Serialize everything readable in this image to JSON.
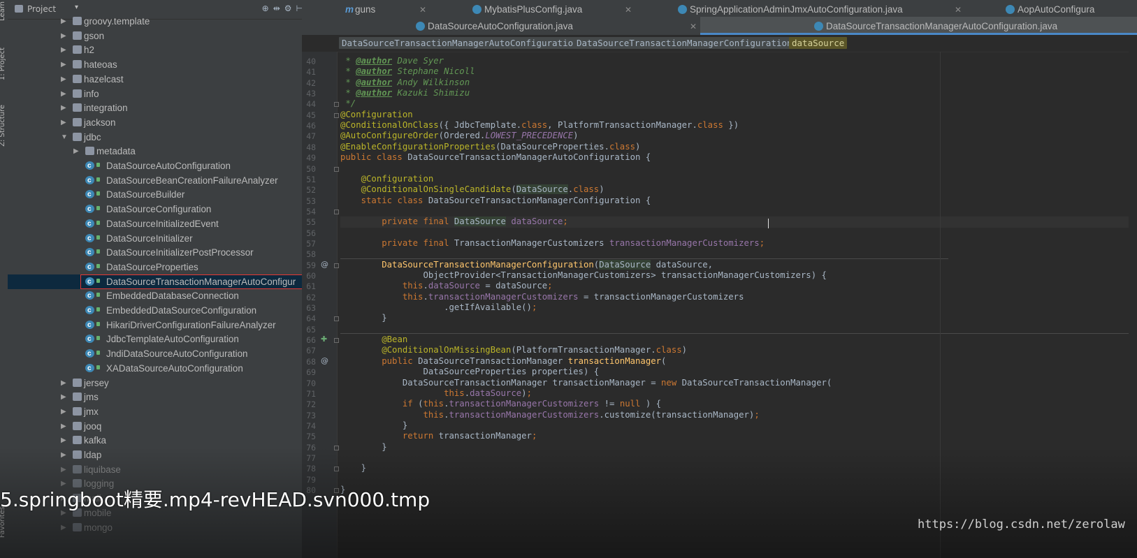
{
  "window": {
    "sidebar_tabs": [
      "Learn",
      "1: Project",
      "Z: Structure",
      "Favorites"
    ]
  },
  "project_panel": {
    "title": "Project",
    "header_icons": [
      "target-icon",
      "split-icon",
      "gear-icon",
      "collapse-icon"
    ],
    "tree": [
      {
        "label": "groovy.template",
        "type": "package",
        "depth": 1,
        "expanded": false
      },
      {
        "label": "gson",
        "type": "package",
        "depth": 1,
        "expanded": false
      },
      {
        "label": "h2",
        "type": "package",
        "depth": 1,
        "expanded": false
      },
      {
        "label": "hateoas",
        "type": "package",
        "depth": 1,
        "expanded": false
      },
      {
        "label": "hazelcast",
        "type": "package",
        "depth": 1,
        "expanded": false
      },
      {
        "label": "info",
        "type": "package",
        "depth": 1,
        "expanded": false
      },
      {
        "label": "integration",
        "type": "package",
        "depth": 1,
        "expanded": false
      },
      {
        "label": "jackson",
        "type": "package",
        "depth": 1,
        "expanded": false
      },
      {
        "label": "jdbc",
        "type": "package",
        "depth": 1,
        "expanded": true
      },
      {
        "label": "metadata",
        "type": "package",
        "depth": 2,
        "expanded": false
      },
      {
        "label": "DataSourceAutoConfiguration",
        "type": "class",
        "depth": 2
      },
      {
        "label": "DataSourceBeanCreationFailureAnalyzer",
        "type": "class",
        "depth": 2
      },
      {
        "label": "DataSourceBuilder",
        "type": "class",
        "depth": 2
      },
      {
        "label": "DataSourceConfiguration",
        "type": "class",
        "depth": 2
      },
      {
        "label": "DataSourceInitializedEvent",
        "type": "class",
        "depth": 2
      },
      {
        "label": "DataSourceInitializer",
        "type": "class",
        "depth": 2
      },
      {
        "label": "DataSourceInitializerPostProcessor",
        "type": "class",
        "depth": 2
      },
      {
        "label": "DataSourceProperties",
        "type": "class",
        "depth": 2
      },
      {
        "label": "DataSourceTransactionManagerAutoConfigur",
        "type": "class",
        "depth": 2,
        "selected": true
      },
      {
        "label": "EmbeddedDatabaseConnection",
        "type": "class",
        "depth": 2
      },
      {
        "label": "EmbeddedDataSourceConfiguration",
        "type": "class",
        "depth": 2
      },
      {
        "label": "HikariDriverConfigurationFailureAnalyzer",
        "type": "class",
        "depth": 2
      },
      {
        "label": "JdbcTemplateAutoConfiguration",
        "type": "class",
        "depth": 2
      },
      {
        "label": "JndiDataSourceAutoConfiguration",
        "type": "class",
        "depth": 2
      },
      {
        "label": "XADataSourceAutoConfiguration",
        "type": "class",
        "depth": 2
      },
      {
        "label": "jersey",
        "type": "package",
        "depth": 1,
        "expanded": false
      },
      {
        "label": "jms",
        "type": "package",
        "depth": 1,
        "expanded": false
      },
      {
        "label": "jmx",
        "type": "package",
        "depth": 1,
        "expanded": false
      },
      {
        "label": "jooq",
        "type": "package",
        "depth": 1,
        "expanded": false
      },
      {
        "label": "kafka",
        "type": "package",
        "depth": 1,
        "expanded": false
      },
      {
        "label": "ldap",
        "type": "package",
        "depth": 1,
        "expanded": false
      },
      {
        "label": "liquibase",
        "type": "package",
        "depth": 1,
        "expanded": false
      },
      {
        "label": "logging",
        "type": "package",
        "depth": 1,
        "expanded": false
      },
      {
        "label": "mail",
        "type": "package",
        "depth": 1,
        "expanded": false
      },
      {
        "label": "mobile",
        "type": "package",
        "depth": 1,
        "expanded": false
      },
      {
        "label": "mongo",
        "type": "package",
        "depth": 1,
        "expanded": false
      }
    ]
  },
  "editor": {
    "tabs_row1": [
      {
        "label": "guns",
        "icon": "m-icon"
      },
      {
        "label": "MybatisPlusConfig.java",
        "icon": "class-icon"
      },
      {
        "label": "SpringApplicationAdminJmxAutoConfiguration.java",
        "icon": "class-icon"
      },
      {
        "label": "AopAutoConfigura",
        "icon": "class-icon"
      }
    ],
    "tabs_row2": [
      {
        "label": "DataSourceAutoConfiguration.java",
        "icon": "class-icon"
      },
      {
        "label": "DataSourceTransactionManagerAutoConfiguration.java",
        "icon": "class-icon",
        "active": true
      }
    ],
    "breadcrumbs": [
      "DataSourceTransactionManagerAutoConfiguration",
      "DataSourceTransactionManagerConfiguration",
      "dataSource"
    ],
    "first_line_number": 40,
    "lines": [
      [
        [
          "cm",
          " * "
        ],
        [
          "tag",
          "@author"
        ],
        [
          "cm",
          " Dave Syer"
        ]
      ],
      [
        [
          "cm",
          " * "
        ],
        [
          "tag",
          "@author"
        ],
        [
          "cm",
          " Stephane Nicoll"
        ]
      ],
      [
        [
          "cm",
          " * "
        ],
        [
          "tag",
          "@author"
        ],
        [
          "cm",
          " Andy Wilkinson"
        ]
      ],
      [
        [
          "cm",
          " * "
        ],
        [
          "tag",
          "@author"
        ],
        [
          "cm",
          " Kazuki Shimizu"
        ]
      ],
      [
        [
          "cm",
          " */"
        ]
      ],
      [
        [
          "an",
          "@Configuration"
        ]
      ],
      [
        [
          "an",
          "@ConditionalOnClass"
        ],
        [
          "",
          "({ JdbcTemplate."
        ],
        [
          "kw",
          "class"
        ],
        [
          "",
          ", PlatformTransactionManager."
        ],
        [
          "kw",
          "class"
        ],
        [
          "",
          " })"
        ]
      ],
      [
        [
          "an",
          "@AutoConfigureOrder"
        ],
        [
          "",
          "(Ordered."
        ],
        [
          "st",
          "LOWEST_PRECEDENCE"
        ],
        [
          "",
          ")"
        ]
      ],
      [
        [
          "an",
          "@EnableConfigurationProperties"
        ],
        [
          "",
          "(DataSourceProperties."
        ],
        [
          "kw",
          "class"
        ],
        [
          "",
          ")"
        ]
      ],
      [
        [
          "kw",
          "public class "
        ],
        [
          "",
          "DataSourceTransactionManagerAutoConfiguration {"
        ]
      ],
      [
        [
          "",
          ""
        ]
      ],
      [
        [
          "",
          "    "
        ],
        [
          "an",
          "@Configuration"
        ]
      ],
      [
        [
          "",
          "    "
        ],
        [
          "an",
          "@ConditionalOnSingleCandidate"
        ],
        [
          "",
          "("
        ],
        [
          "hl",
          "DataSource"
        ],
        [
          "",
          "."
        ],
        [
          "kw",
          "class"
        ],
        [
          "",
          ")"
        ]
      ],
      [
        [
          "",
          "    "
        ],
        [
          "kw",
          "static class "
        ],
        [
          "",
          "DataSourceTransactionManagerConfiguration {"
        ]
      ],
      [
        [
          "",
          ""
        ]
      ],
      [
        [
          "",
          "        "
        ],
        [
          "kw",
          "private final "
        ],
        [
          "hl",
          "DataSource"
        ],
        [
          "",
          " "
        ],
        [
          "fd",
          "dataSource"
        ],
        [
          "kw",
          ";"
        ]
      ],
      [
        [
          "",
          ""
        ]
      ],
      [
        [
          "",
          "        "
        ],
        [
          "kw",
          "private final "
        ],
        [
          "",
          "TransactionManagerCustomizers "
        ],
        [
          "fd",
          "transactionManagerCustomizers"
        ],
        [
          "kw",
          ";"
        ]
      ],
      [
        [
          "",
          ""
        ]
      ],
      [
        [
          "",
          "        "
        ],
        [
          "mt",
          "DataSourceTransactionManagerConfiguration"
        ],
        [
          "",
          "("
        ],
        [
          "hl",
          "DataSource"
        ],
        [
          "",
          " dataSource,"
        ]
      ],
      [
        [
          "",
          "                ObjectProvider<TransactionManagerCustomizers> transactionManagerCustomizers) {"
        ]
      ],
      [
        [
          "",
          "            "
        ],
        [
          "kw",
          "this"
        ],
        [
          "",
          "."
        ],
        [
          "fd",
          "dataSource"
        ],
        [
          "",
          " = dataSource"
        ],
        [
          "kw",
          ";"
        ]
      ],
      [
        [
          "",
          "            "
        ],
        [
          "kw",
          "this"
        ],
        [
          "",
          "."
        ],
        [
          "fd",
          "transactionManagerCustomizers"
        ],
        [
          "",
          " = transactionManagerCustomizers"
        ]
      ],
      [
        [
          "",
          "                    .getIfAvailable()"
        ],
        [
          "kw",
          ";"
        ]
      ],
      [
        [
          "",
          "        }"
        ]
      ],
      [
        [
          "",
          ""
        ]
      ],
      [
        [
          "",
          "        "
        ],
        [
          "an",
          "@Bean"
        ]
      ],
      [
        [
          "",
          "        "
        ],
        [
          "an",
          "@ConditionalOnMissingBean"
        ],
        [
          "",
          "(PlatformTransactionManager."
        ],
        [
          "kw",
          "class"
        ],
        [
          "",
          ")"
        ]
      ],
      [
        [
          "",
          "        "
        ],
        [
          "kw",
          "public "
        ],
        [
          "",
          "DataSourceTransactionManager "
        ],
        [
          "mt",
          "transactionManager"
        ],
        [
          "",
          "("
        ]
      ],
      [
        [
          "",
          "                DataSourceProperties properties) {"
        ]
      ],
      [
        [
          "",
          "            DataSourceTransactionManager transactionManager = "
        ],
        [
          "kw",
          "new "
        ],
        [
          "",
          "DataSourceTransactionManager("
        ]
      ],
      [
        [
          "",
          "                    "
        ],
        [
          "kw",
          "this"
        ],
        [
          "",
          "."
        ],
        [
          "fd",
          "dataSource"
        ],
        [
          "",
          ")"
        ],
        [
          "kw",
          ";"
        ]
      ],
      [
        [
          "",
          "            "
        ],
        [
          "kw",
          "if "
        ],
        [
          "",
          "("
        ],
        [
          "kw",
          "this"
        ],
        [
          "",
          "."
        ],
        [
          "fd",
          "transactionManagerCustomizers"
        ],
        [
          "",
          " != "
        ],
        [
          "kw",
          "null"
        ],
        [
          "",
          " ) {"
        ]
      ],
      [
        [
          "",
          "                "
        ],
        [
          "kw",
          "this"
        ],
        [
          "",
          "."
        ],
        [
          "fd",
          "transactionManagerCustomizers"
        ],
        [
          "",
          ".customize(transactionManager)"
        ],
        [
          "kw",
          ";"
        ]
      ],
      [
        [
          "",
          "            }"
        ]
      ],
      [
        [
          "",
          "            "
        ],
        [
          "kw",
          "return "
        ],
        [
          "",
          "transactionManager"
        ],
        [
          "kw",
          ";"
        ]
      ],
      [
        [
          "",
          "        }"
        ]
      ],
      [
        [
          "",
          ""
        ]
      ],
      [
        [
          "",
          "    }"
        ]
      ],
      [
        [
          "",
          ""
        ]
      ],
      [
        [
          "",
          "}"
        ]
      ]
    ]
  },
  "overlay": {
    "video_title": "5.springboot精要.mp4-revHEAD.svn000.tmp",
    "watermark": "https://blog.csdn.net/zerolaw"
  }
}
